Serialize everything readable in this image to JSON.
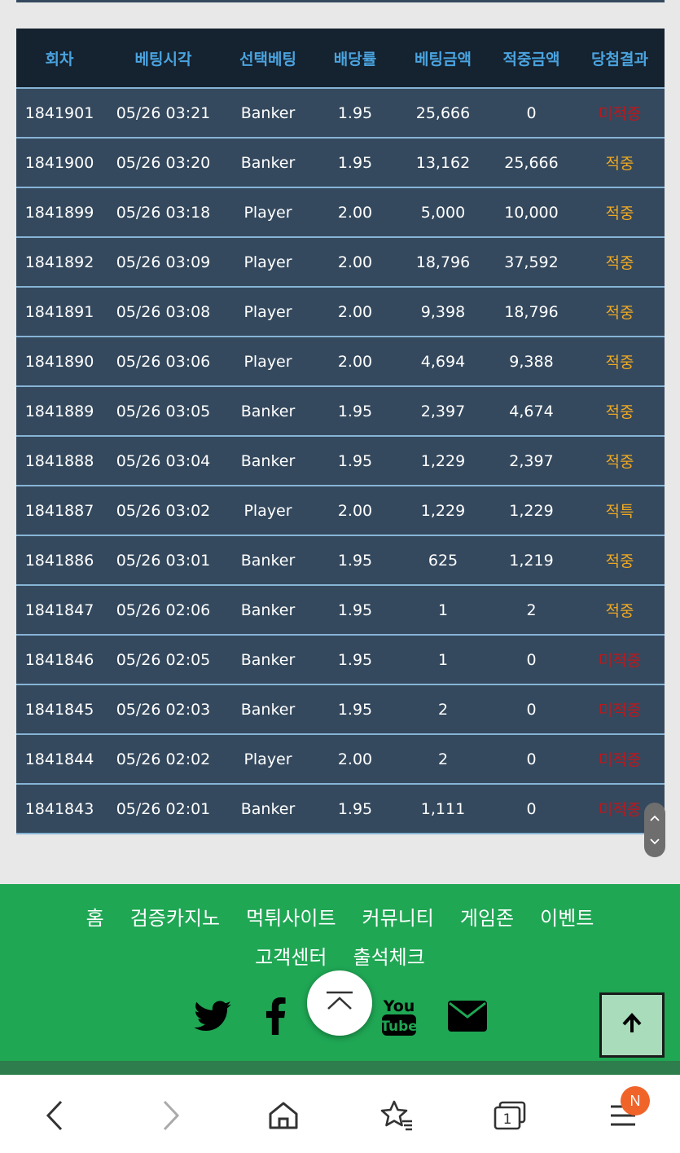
{
  "table": {
    "headers": [
      "회차",
      "베팅시각",
      "선택베팅",
      "배당률",
      "베팅금액",
      "적중금액",
      "당첨결과"
    ],
    "rows": [
      {
        "round": "1841901",
        "time": "05/26 03:21",
        "pick": "Banker",
        "odds": "1.95",
        "bet": "25,666",
        "payout": "0",
        "result": "미적중",
        "status": "lose"
      },
      {
        "round": "1841900",
        "time": "05/26 03:20",
        "pick": "Banker",
        "odds": "1.95",
        "bet": "13,162",
        "payout": "25,666",
        "result": "적중",
        "status": "win"
      },
      {
        "round": "1841899",
        "time": "05/26 03:18",
        "pick": "Player",
        "odds": "2.00",
        "bet": "5,000",
        "payout": "10,000",
        "result": "적중",
        "status": "win"
      },
      {
        "round": "1841892",
        "time": "05/26 03:09",
        "pick": "Player",
        "odds": "2.00",
        "bet": "18,796",
        "payout": "37,592",
        "result": "적중",
        "status": "win"
      },
      {
        "round": "1841891",
        "time": "05/26 03:08",
        "pick": "Player",
        "odds": "2.00",
        "bet": "9,398",
        "payout": "18,796",
        "result": "적중",
        "status": "win"
      },
      {
        "round": "1841890",
        "time": "05/26 03:06",
        "pick": "Player",
        "odds": "2.00",
        "bet": "4,694",
        "payout": "9,388",
        "result": "적중",
        "status": "win"
      },
      {
        "round": "1841889",
        "time": "05/26 03:05",
        "pick": "Banker",
        "odds": "1.95",
        "bet": "2,397",
        "payout": "4,674",
        "result": "적중",
        "status": "win"
      },
      {
        "round": "1841888",
        "time": "05/26 03:04",
        "pick": "Banker",
        "odds": "1.95",
        "bet": "1,229",
        "payout": "2,397",
        "result": "적중",
        "status": "win"
      },
      {
        "round": "1841887",
        "time": "05/26 03:02",
        "pick": "Player",
        "odds": "2.00",
        "bet": "1,229",
        "payout": "1,229",
        "result": "적특",
        "status": "win"
      },
      {
        "round": "1841886",
        "time": "05/26 03:01",
        "pick": "Banker",
        "odds": "1.95",
        "bet": "625",
        "payout": "1,219",
        "result": "적중",
        "status": "win"
      },
      {
        "round": "1841847",
        "time": "05/26 02:06",
        "pick": "Banker",
        "odds": "1.95",
        "bet": "1",
        "payout": "2",
        "result": "적중",
        "status": "win"
      },
      {
        "round": "1841846",
        "time": "05/26 02:05",
        "pick": "Banker",
        "odds": "1.95",
        "bet": "1",
        "payout": "0",
        "result": "미적중",
        "status": "lose"
      },
      {
        "round": "1841845",
        "time": "05/26 02:03",
        "pick": "Banker",
        "odds": "1.95",
        "bet": "2",
        "payout": "0",
        "result": "미적중",
        "status": "lose"
      },
      {
        "round": "1841844",
        "time": "05/26 02:02",
        "pick": "Player",
        "odds": "2.00",
        "bet": "2",
        "payout": "0",
        "result": "미적중",
        "status": "lose"
      },
      {
        "round": "1841843",
        "time": "05/26 02:01",
        "pick": "Banker",
        "odds": "1.95",
        "bet": "1,111",
        "payout": "0",
        "result": "미적중",
        "status": "lose"
      }
    ]
  },
  "footer": {
    "nav": [
      "홈",
      "검증카지노",
      "먹튀사이트",
      "커뮤니티",
      "게임존",
      "이벤트",
      "고객센터",
      "출석체크"
    ],
    "social_icons": [
      "twitter-icon",
      "facebook-icon",
      "youtube-icon",
      "email-icon"
    ],
    "youtube_logo_text": [
      "You",
      "Tube"
    ]
  },
  "browser": {
    "buttons": [
      "back-icon",
      "forward-icon",
      "home-icon",
      "bookmarks-icon",
      "tabs-icon",
      "menu-icon"
    ],
    "tab_count": "1",
    "menu_badge": "N"
  },
  "colors": {
    "header_bg": "#15222f",
    "header_text": "#4aa3df",
    "row_bg": "#34495e",
    "row_border": "#87b4d6",
    "result_lose": "#c0161b",
    "result_win": "#f0a820",
    "footer_bg": "#1fa754",
    "badge": "#f0642a"
  }
}
